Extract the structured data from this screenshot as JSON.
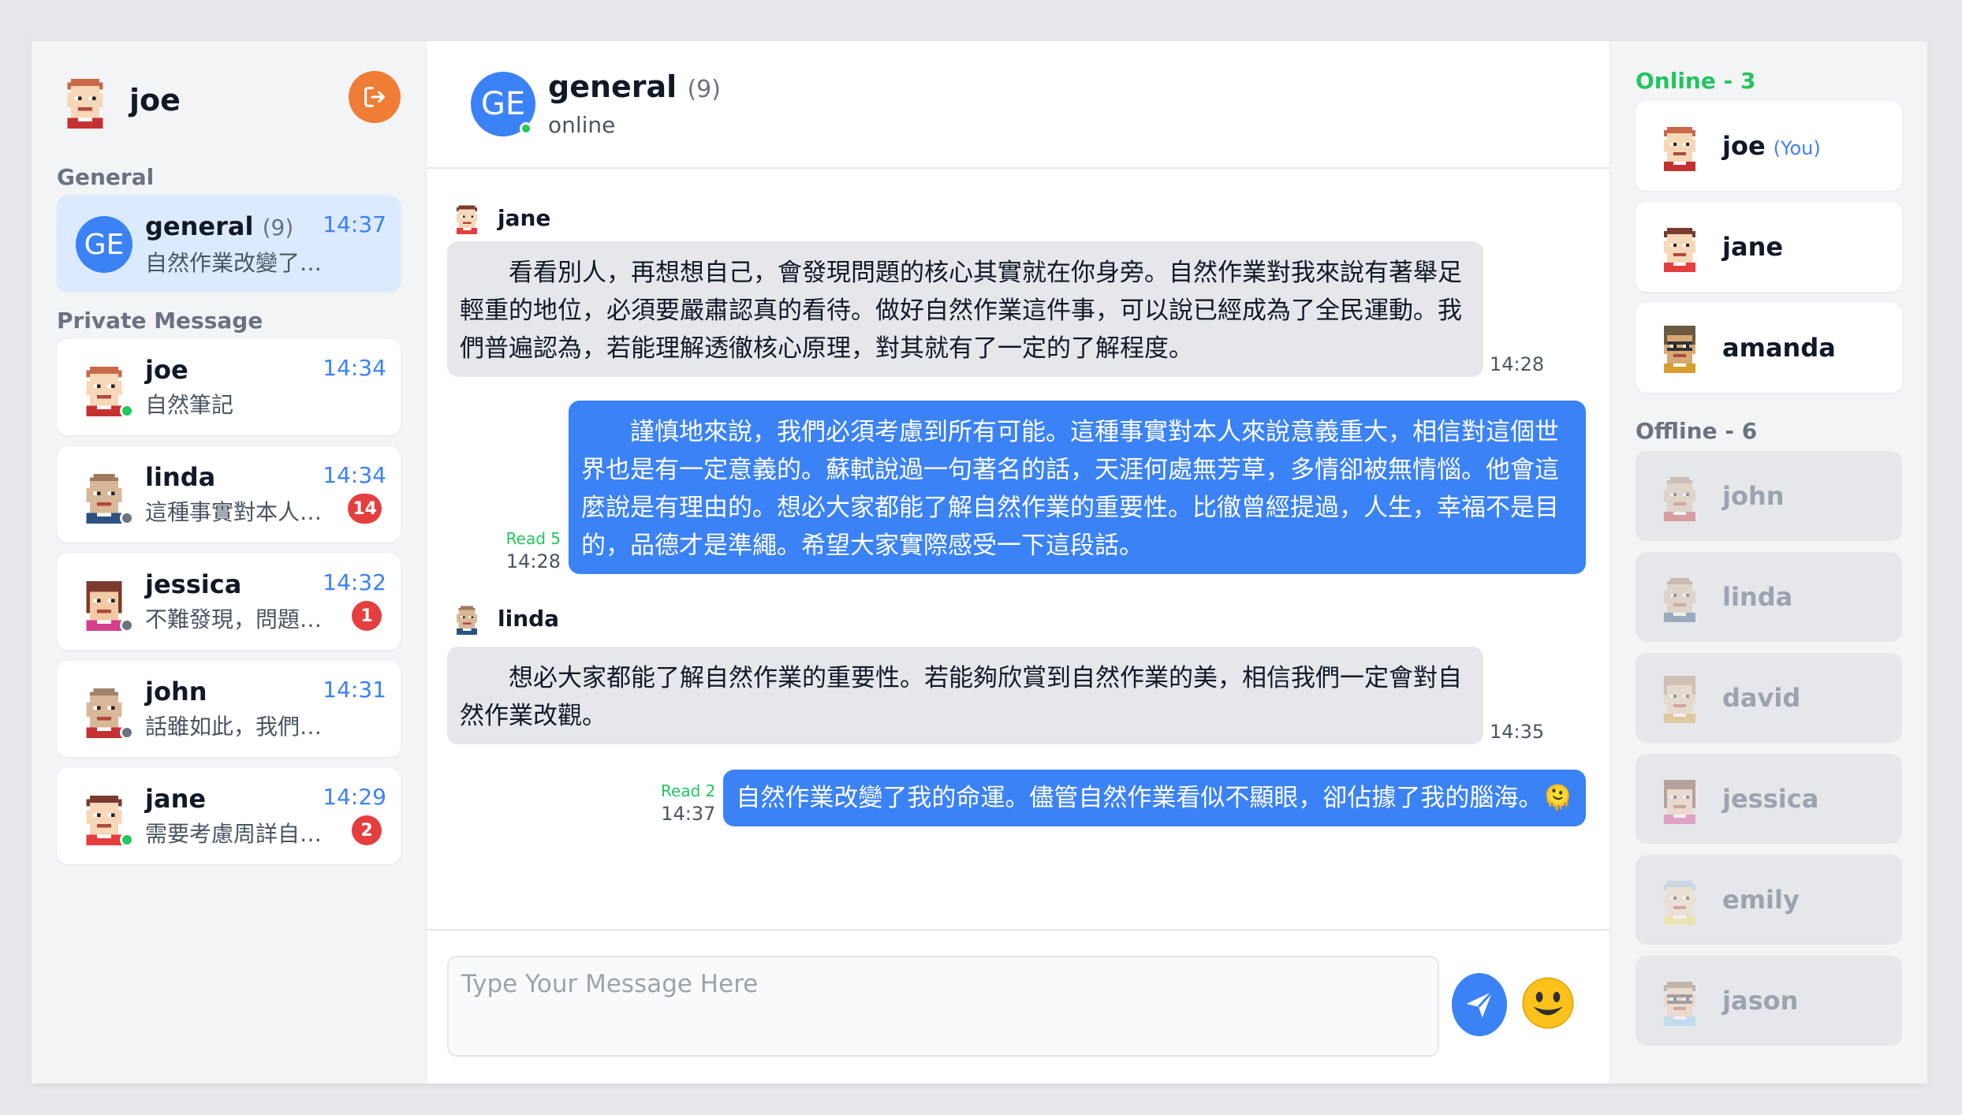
{
  "me": {
    "name": "joe",
    "avatar": "pixel-avatar-joe"
  },
  "colors": {
    "accent": "#3b82f6",
    "logout": "#ef7d35",
    "online": "#22c55e",
    "unread": "#e53e3e",
    "bubble_in": "#e5e7eb",
    "bubble_out": "#3b82f6"
  },
  "sidebar": {
    "general_label": "General",
    "private_label": "Private Message",
    "general": {
      "initials": "GE",
      "name": "general",
      "count": "(9)",
      "time": "14:37",
      "last": "自然作業改變了我..."
    },
    "private": [
      {
        "name": "joe",
        "time": "14:34",
        "last": "自然筆記",
        "unread": "",
        "status": "online"
      },
      {
        "name": "linda",
        "time": "14:34",
        "last": "這種事實對本人來...",
        "unread": "14",
        "status": "offline"
      },
      {
        "name": "jessica",
        "time": "14:32",
        "last": "不難發現，問題在...",
        "unread": "1",
        "status": "offline"
      },
      {
        "name": "john",
        "time": "14:31",
        "last": "話雖如此，我們卻...",
        "unread": "",
        "status": "offline"
      },
      {
        "name": "jane",
        "time": "14:29",
        "last": "需要考慮周詳自然...",
        "unread": "2",
        "status": "online"
      }
    ]
  },
  "chat": {
    "initials": "GE",
    "title": "general",
    "count": "(9)",
    "status": "online",
    "messages": [
      {
        "author": "jane",
        "text": "看看別人，再想想自己，會發現問題的核心其實就在你身旁。自然作業對我來說有著舉足輕重的地位，必須要嚴肅認真的看待。做好自然作業這件事，可以說已經成為了全民運動。我們普遍認為，若能理解透徹核心原理，對其就有了一定的了解程度。",
        "time": "14:28"
      },
      {
        "author": "me",
        "read": "Read 5",
        "text": "謹慎地來說，我們必須考慮到所有可能。這種事實對本人來說意義重大，相信對這個世界也是有一定意義的。蘇軾說過一句著名的話，天涯何處無芳草，多情卻被無情惱。他會這麼說是有理由的。想必大家都能了解自然作業的重要性。比徹曾經提過，人生，幸福不是目的，品德才是準繩。希望大家實際感受一下這段話。",
        "time": "14:28"
      },
      {
        "author": "linda",
        "text": "想必大家都能了解自然作業的重要性。若能夠欣賞到自然作業的美，相信我們一定會對自然作業改觀。",
        "time": "14:35"
      },
      {
        "author": "me",
        "read": "Read 2",
        "text": "自然作業改變了我的命運。儘管自然作業看似不顯眼，卻佔據了我的腦海。🫠",
        "time": "14:37"
      }
    ],
    "input_placeholder": "Type Your Message Here"
  },
  "users": {
    "online_label": "Online - 3",
    "offline_label": "Offline - 6",
    "you_tag": "(You)",
    "online": [
      "joe",
      "jane",
      "amanda"
    ],
    "offline": [
      "john",
      "linda",
      "david",
      "jessica",
      "emily",
      "jason"
    ]
  }
}
